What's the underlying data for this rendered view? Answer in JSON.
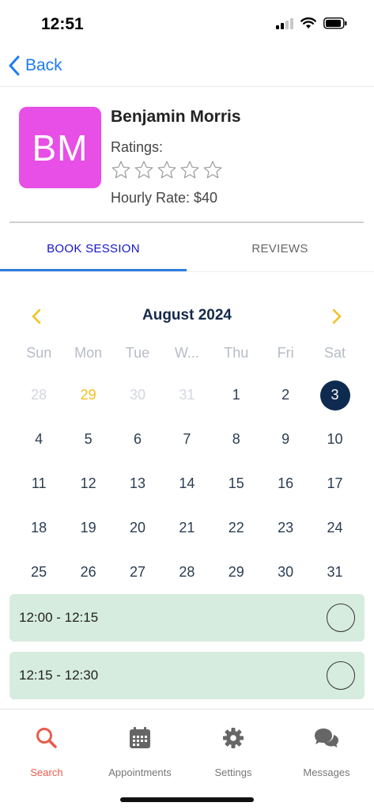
{
  "status_bar": {
    "time": "12:51"
  },
  "nav": {
    "back_label": "Back"
  },
  "profile": {
    "initials": "BM",
    "name": "Benjamin Morris",
    "ratings_label": "Ratings:",
    "rating_value": 0,
    "rating_max": 5,
    "hourly_rate": "Hourly Rate: $40",
    "avatar_color": "#e74fe6"
  },
  "tabs": {
    "book_session": "BOOK SESSION",
    "reviews": "REVIEWS",
    "active": "book_session"
  },
  "calendar": {
    "month_title": "August 2024",
    "weekdays": [
      "Sun",
      "Mon",
      "Tue",
      "W...",
      "Thu",
      "Fri",
      "Sat"
    ],
    "days": [
      {
        "d": "28",
        "state": "muted"
      },
      {
        "d": "29",
        "state": "today"
      },
      {
        "d": "30",
        "state": "muted"
      },
      {
        "d": "31",
        "state": "muted"
      },
      {
        "d": "1",
        "state": "normal"
      },
      {
        "d": "2",
        "state": "normal"
      },
      {
        "d": "3",
        "state": "selected"
      },
      {
        "d": "4",
        "state": "normal"
      },
      {
        "d": "5",
        "state": "normal"
      },
      {
        "d": "6",
        "state": "normal"
      },
      {
        "d": "7",
        "state": "normal"
      },
      {
        "d": "8",
        "state": "normal"
      },
      {
        "d": "9",
        "state": "normal"
      },
      {
        "d": "10",
        "state": "normal"
      },
      {
        "d": "11",
        "state": "normal"
      },
      {
        "d": "12",
        "state": "normal"
      },
      {
        "d": "13",
        "state": "normal"
      },
      {
        "d": "14",
        "state": "normal"
      },
      {
        "d": "15",
        "state": "normal"
      },
      {
        "d": "16",
        "state": "normal"
      },
      {
        "d": "17",
        "state": "normal"
      },
      {
        "d": "18",
        "state": "normal"
      },
      {
        "d": "19",
        "state": "normal"
      },
      {
        "d": "20",
        "state": "normal"
      },
      {
        "d": "21",
        "state": "normal"
      },
      {
        "d": "22",
        "state": "normal"
      },
      {
        "d": "23",
        "state": "normal"
      },
      {
        "d": "24",
        "state": "normal"
      },
      {
        "d": "25",
        "state": "normal"
      },
      {
        "d": "26",
        "state": "normal"
      },
      {
        "d": "27",
        "state": "normal"
      },
      {
        "d": "28",
        "state": "normal"
      },
      {
        "d": "29",
        "state": "normal"
      },
      {
        "d": "30",
        "state": "normal"
      },
      {
        "d": "31",
        "state": "normal"
      }
    ],
    "selected_color": "#0f2a4f",
    "today_color": "#f2c01d"
  },
  "time_slots": [
    {
      "label": "12:00 - 12:15",
      "selected": false
    },
    {
      "label": "12:15 - 12:30",
      "selected": false
    }
  ],
  "tabbar": {
    "items": [
      {
        "label": "Search",
        "icon": "search-icon",
        "active": true
      },
      {
        "label": "Appointments",
        "icon": "calendar-icon",
        "active": false
      },
      {
        "label": "Settings",
        "icon": "gear-icon",
        "active": false
      },
      {
        "label": "Messages",
        "icon": "chat-bubbles-icon",
        "active": false
      }
    ],
    "active_color": "#e95b4c"
  }
}
